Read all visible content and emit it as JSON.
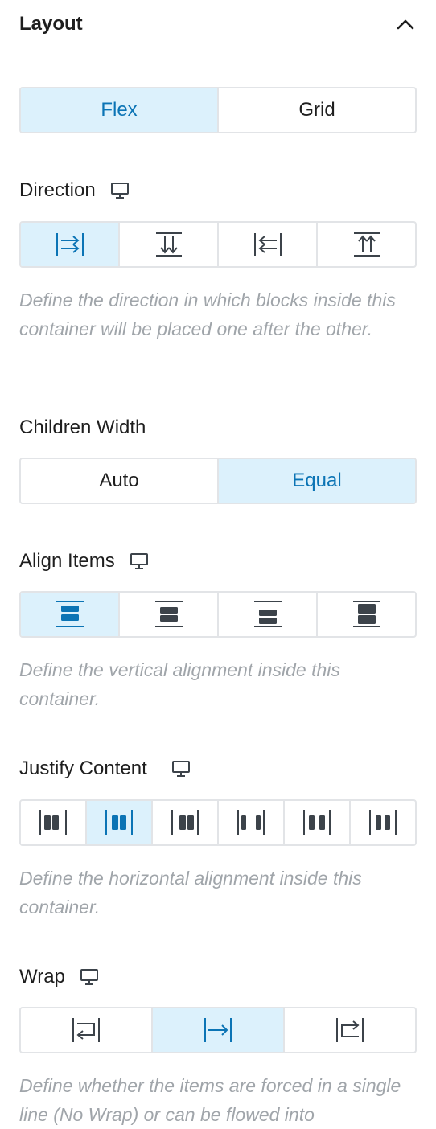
{
  "panel": {
    "title": "Layout",
    "toggle_icon": "chevron-up-icon"
  },
  "layout_type": {
    "options": [
      "Flex",
      "Grid"
    ],
    "selected": "Flex"
  },
  "direction": {
    "label": "Direction",
    "device_icon": "desktop-icon",
    "options": [
      "row-icon",
      "column-icon",
      "row-reverse-icon",
      "column-reverse-icon"
    ],
    "selected_index": 0,
    "help": "Define the direction in which blocks inside this container will be placed one after the other."
  },
  "children_width": {
    "label": "Children Width",
    "options": [
      "Auto",
      "Equal"
    ],
    "selected": "Equal"
  },
  "align_items": {
    "label": "Align Items",
    "device_icon": "desktop-icon",
    "options": [
      "align-start-icon",
      "align-center-icon",
      "align-end-icon",
      "align-stretch-icon"
    ],
    "selected_index": 0,
    "help": "Define the vertical alignment inside this container."
  },
  "justify_content": {
    "label": "Justify Content",
    "device_icon": "desktop-icon",
    "options": [
      "justify-start-icon",
      "justify-center-icon",
      "justify-end-icon",
      "justify-space-between-icon",
      "justify-space-around-icon",
      "justify-space-evenly-icon"
    ],
    "selected_index": 1,
    "help": "Define the horizontal alignment inside this container."
  },
  "wrap": {
    "label": "Wrap",
    "device_icon": "desktop-icon",
    "options": [
      "wrap-icon",
      "nowrap-icon",
      "wrap-reverse-icon"
    ],
    "selected_index": 1,
    "help": "Define whether the items are forced in a single line (No Wrap) or can be flowed into"
  },
  "colors": {
    "active_bg": "#dcf1fc",
    "active_fg": "#0b74b5",
    "icon": "#3c434a",
    "help": "#a0a5aa"
  }
}
